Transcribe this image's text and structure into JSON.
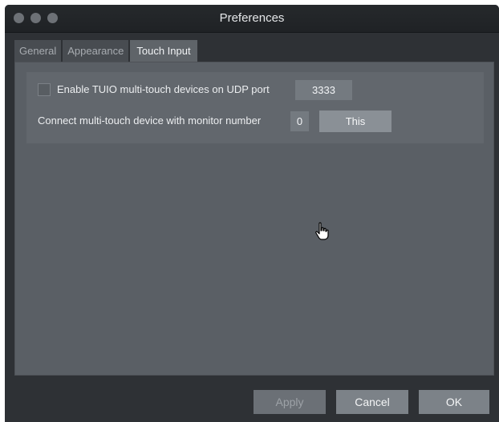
{
  "window": {
    "title": "Preferences"
  },
  "tabs": [
    {
      "label": "General",
      "active": false
    },
    {
      "label": "Appearance",
      "active": false
    },
    {
      "label": "Touch Input",
      "active": true
    }
  ],
  "touch_input": {
    "tuio_checkbox": {
      "checked": false
    },
    "tuio_label": "Enable TUIO multi-touch devices on UDP port",
    "udp_port": "3333",
    "monitor_label": "Connect multi-touch device with monitor number",
    "monitor_number": "0",
    "this_button": "This"
  },
  "buttons": {
    "apply": "Apply",
    "cancel": "Cancel",
    "ok": "OK"
  },
  "cursor": {
    "icon": "hand-pointer-icon"
  }
}
